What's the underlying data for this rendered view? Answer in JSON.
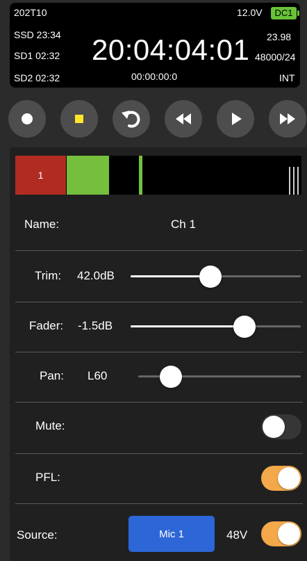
{
  "status": {
    "scene_take": "202T10",
    "voltage": "12.0V",
    "power_source": "DC1",
    "power_color": "#67c337",
    "ssd": "SSD 23:34",
    "sd1": "SD1 02:32",
    "sd2": "SD2 02:32",
    "timecode": "20:04:04:01",
    "frame_rate": "23.98",
    "sample_format": "48000/24",
    "user_bits": "00:00:00:0",
    "tc_mode": "INT"
  },
  "transport": {
    "record_icon": "record-icon",
    "stop_icon": "stop-icon",
    "stop_color": "#ffe82a",
    "undo_icon": "undo-icon",
    "rewind_icon": "rewind-icon",
    "play_icon": "play-icon",
    "fast_forward_icon": "fast-forward-icon"
  },
  "meter": {
    "channel_number": "1",
    "armed_color": "#b02c23",
    "level_color": "#76bf3d"
  },
  "channel": {
    "name_label": "Name:",
    "name_value": "Ch 1",
    "trim_label": "Trim:",
    "trim_value": "42.0dB",
    "trim_position": 0.47,
    "fader_label": "Fader:",
    "fader_value": "-1.5dB",
    "fader_position": 0.67,
    "pan_label": "Pan:",
    "pan_value": "L60",
    "pan_position": 0.2,
    "mute_label": "Mute:",
    "mute_on": false,
    "pfl_label": "PFL:",
    "pfl_on": true,
    "source_label": "Source:",
    "source_value": "Mic 1",
    "phantom_label": "48V",
    "phantom_on": true,
    "accent_color": "#f3a84a",
    "source_button_color": "#2d66d6"
  }
}
